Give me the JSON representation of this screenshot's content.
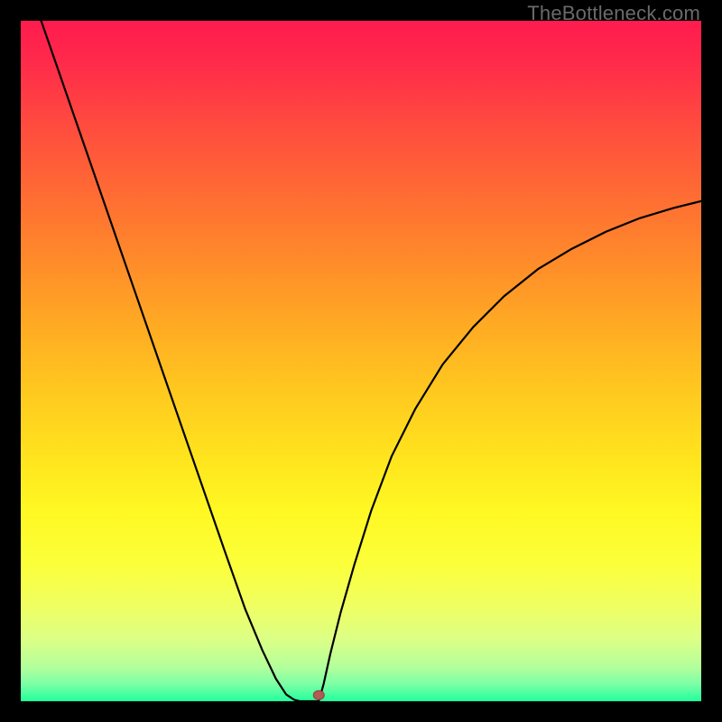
{
  "watermark": "TheBottleneck.com",
  "chart_data": {
    "type": "line",
    "title": "",
    "xlabel": "",
    "ylabel": "",
    "xlim": [
      0,
      100
    ],
    "ylim": [
      0,
      100
    ],
    "background_gradient_stops": [
      {
        "pos": 0.0,
        "color": "#ff1b4e"
      },
      {
        "pos": 0.06,
        "color": "#ff2a4a"
      },
      {
        "pos": 0.15,
        "color": "#ff4a3f"
      },
      {
        "pos": 0.25,
        "color": "#ff6a34"
      },
      {
        "pos": 0.35,
        "color": "#ff8a2a"
      },
      {
        "pos": 0.45,
        "color": "#ffab23"
      },
      {
        "pos": 0.55,
        "color": "#ffca1f"
      },
      {
        "pos": 0.65,
        "color": "#ffe61e"
      },
      {
        "pos": 0.72,
        "color": "#fff823"
      },
      {
        "pos": 0.8,
        "color": "#fbff3a"
      },
      {
        "pos": 0.86,
        "color": "#f0ff62"
      },
      {
        "pos": 0.91,
        "color": "#dbff86"
      },
      {
        "pos": 0.95,
        "color": "#b3ff9c"
      },
      {
        "pos": 0.975,
        "color": "#7cffa6"
      },
      {
        "pos": 1.0,
        "color": "#22ff9c"
      }
    ],
    "series": [
      {
        "name": "left-branch",
        "x": [
          3.0,
          7.5,
          12.0,
          16.5,
          21.0,
          25.5,
          30.0,
          33.0,
          35.5,
          37.5,
          39.0,
          40.2,
          41.0
        ],
        "y": [
          100.0,
          87.0,
          74.0,
          61.0,
          48.0,
          35.0,
          22.0,
          13.5,
          7.5,
          3.3,
          1.0,
          0.2,
          0.0
        ]
      },
      {
        "name": "flat-bottom",
        "x": [
          41.0,
          42.0,
          43.0,
          43.8
        ],
        "y": [
          0.0,
          0.0,
          0.0,
          0.0
        ]
      },
      {
        "name": "right-branch",
        "x": [
          43.8,
          44.5,
          45.5,
          47.0,
          49.0,
          51.5,
          54.5,
          58.0,
          62.0,
          66.5,
          71.0,
          76.0,
          81.0,
          86.0,
          91.0,
          96.0,
          100.0
        ],
        "y": [
          0.0,
          2.5,
          7.0,
          13.0,
          20.0,
          28.0,
          36.0,
          43.0,
          49.5,
          55.0,
          59.5,
          63.5,
          66.5,
          69.0,
          71.0,
          72.5,
          73.5
        ]
      }
    ],
    "marker": {
      "x": 43.8,
      "y": 0.9,
      "color": "#b35a55"
    }
  }
}
